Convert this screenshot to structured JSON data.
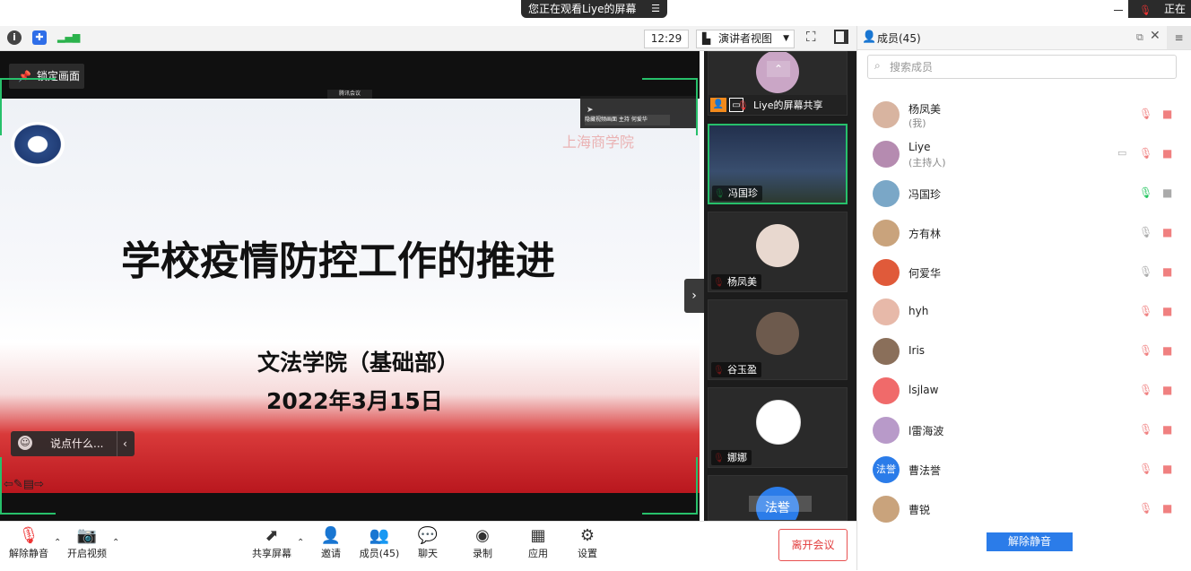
{
  "banner": {
    "text": "您正在观看Liye的屏幕",
    "icon": "list-icon"
  },
  "topright": {
    "text": "正在"
  },
  "toolbar": {
    "time": "12:29",
    "view_label": "演讲者视图"
  },
  "video": {
    "lock_label": "锁定画面",
    "overlay_chip": "腾讯会议",
    "mini_tip": "隐藏视频画面 主持 何爱华",
    "slide_title": "学校疫情防控工作的推进",
    "slide_subtitle": "文法学院（基础部）",
    "slide_date": "2022年3月15日",
    "slide_logo_text": "上海商学院",
    "chat_placeholder": "说点什么..."
  },
  "thumbs": [
    {
      "label": "Liye的屏幕共享",
      "mic": "muted"
    },
    {
      "label": "冯国珍",
      "mic": "active"
    },
    {
      "label": "杨凤美",
      "mic": "muted"
    },
    {
      "label": "谷玉盈",
      "mic": "muted"
    },
    {
      "label": "娜娜",
      "mic": "muted"
    },
    {
      "label": "法誉",
      "mic": "muted"
    }
  ],
  "panel": {
    "title": "成员(45)",
    "search_placeholder": "搜索成员",
    "unmute_all": "解除静音",
    "members": [
      {
        "name": "杨凤美",
        "role": "(我)",
        "avatar": "#d8b4a0",
        "mic": "muted",
        "cam": "off"
      },
      {
        "name": "Liye",
        "role": "(主持人)",
        "avatar": "#b58bb0",
        "mic": "muted",
        "cam": "off",
        "sharing": true
      },
      {
        "name": "冯国珍",
        "role": "",
        "avatar": "#7aa7c7",
        "mic": "active",
        "cam": "off-gray"
      },
      {
        "name": "方有林",
        "role": "",
        "avatar": "#c9a37c",
        "mic": "gray",
        "cam": "off"
      },
      {
        "name": "何爱华",
        "role": "",
        "avatar": "#e05a3a",
        "mic": "gray",
        "cam": "off"
      },
      {
        "name": "hyh",
        "role": "",
        "avatar": "#e7b9a9",
        "mic": "muted",
        "cam": "off"
      },
      {
        "name": "Iris",
        "role": "",
        "avatar": "#8a6f5a",
        "mic": "muted",
        "cam": "off"
      },
      {
        "name": "lsjlaw",
        "role": "",
        "avatar": "#f06a6a",
        "mic": "muted",
        "cam": "off"
      },
      {
        "name": "l雷海波",
        "role": "",
        "avatar": "#b89ac9",
        "mic": "muted",
        "cam": "off"
      },
      {
        "name": "曹法誉",
        "role": "",
        "avatar": "#2b7ce9",
        "avatar_text": "法誉",
        "mic": "muted",
        "cam": "off"
      },
      {
        "name": "曹锐",
        "role": "",
        "avatar": "#c9a37c",
        "mic": "muted",
        "cam": "off"
      }
    ]
  },
  "bottom": {
    "unmute": "解除静音",
    "video": "开启视频",
    "share": "共享屏幕",
    "invite": "邀请",
    "members": "成员(45)",
    "chat": "聊天",
    "record": "录制",
    "apps": "应用",
    "settings": "设置",
    "leave": "离开会议"
  }
}
